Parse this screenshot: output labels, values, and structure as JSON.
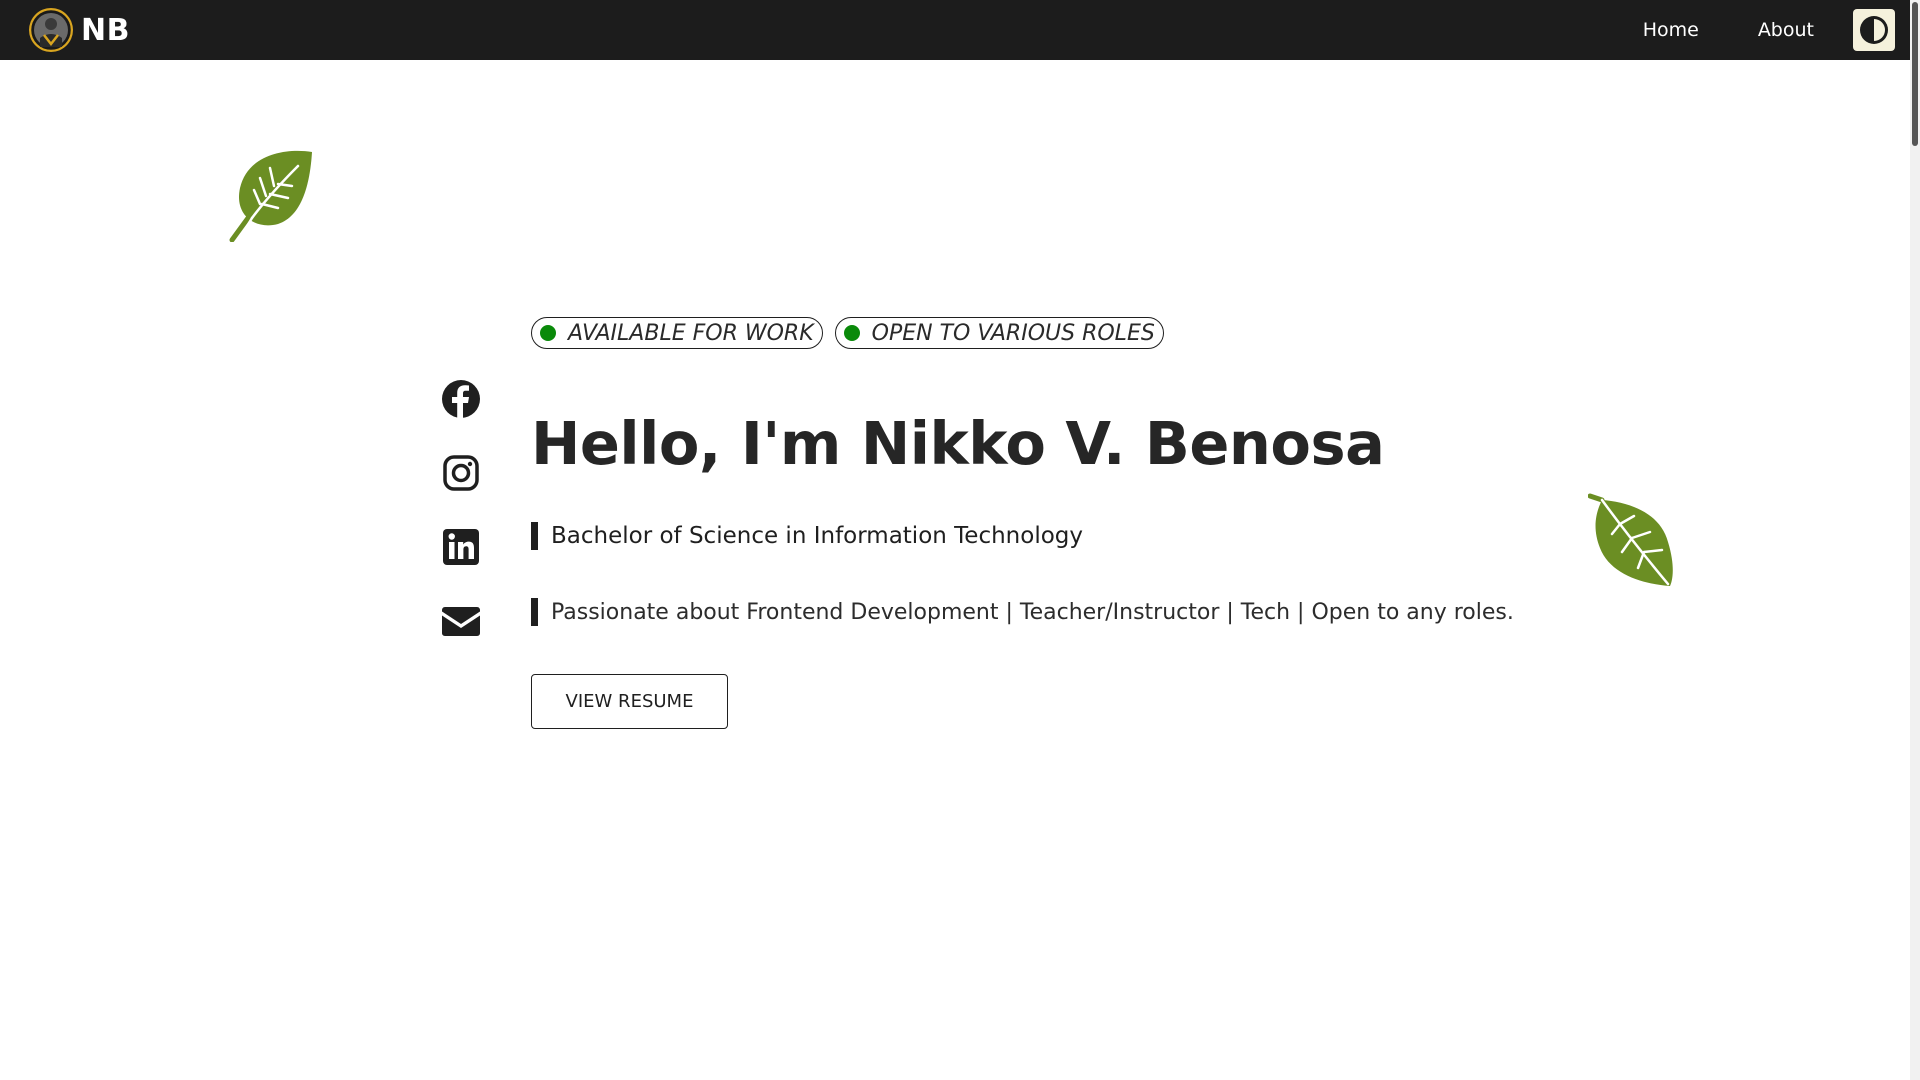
{
  "navbar": {
    "brand_text": "NB",
    "links": [
      {
        "label": "Home"
      },
      {
        "label": "About"
      }
    ]
  },
  "hero": {
    "badges": [
      {
        "label": "AVAILABLE FOR WORK",
        "dot_color": "#0a8a0a"
      },
      {
        "label": "OPEN TO VARIOUS ROLES",
        "dot_color": "#0a8a0a"
      }
    ],
    "title": "Hello, I'm Nikko V. Benosa",
    "degree": "Bachelor of Science in Information Technology",
    "tagline": "Passionate about Frontend Development | Teacher/Instructor | Tech | Open to any roles.",
    "resume_button": "VIEW RESUME"
  },
  "social": {
    "icons": [
      "facebook-icon",
      "instagram-icon",
      "linkedin-icon",
      "email-icon"
    ]
  },
  "colors": {
    "navbar_bg": "#1c1c1c",
    "leaf_green": "#6b8e23",
    "status_green": "#0a8a0a",
    "toggle_bg": "#f5f1dc"
  }
}
